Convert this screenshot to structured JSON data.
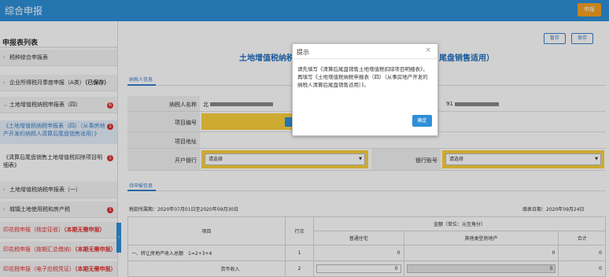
{
  "header": {
    "title": "综合申报",
    "report_button": "申报"
  },
  "sidebar": {
    "title": "申报表列表",
    "items": [
      {
        "label": "税种综合申报表"
      },
      {
        "label": "企业所得税月季度申报（A类）",
        "status": "（已保存）"
      },
      {
        "label": "土地增值税纳税申报表（四）",
        "badge": "6"
      },
      {
        "label": "《土地增值税纳税申报表（四）（从事房地产开发的纳税人清算后尾盘销售适用）》",
        "badge": "1"
      },
      {
        "label": "《清算后尾盘销售土地增值税扣除项目明细表》",
        "badge": "1"
      },
      {
        "label": "土地增值税纳税申报表（一）"
      },
      {
        "label": "城镇土地使用税和房产税",
        "badge": "1"
      },
      {
        "label": "印花税申报（核定征收）",
        "status": "（本期无需申报）"
      },
      {
        "label": "印花税申报（按期汇总缴纳）",
        "status": "（本期无需申报）"
      },
      {
        "label": "印花税申报（电子应税凭证）",
        "status": "（本期无需申报）"
      }
    ],
    "collapse_icon": "‹"
  },
  "toolbar": {
    "draft": "暂存",
    "save": "保存"
  },
  "form": {
    "title": "土地增值税纳税申报表（四）（从事房地产开发的纳税人清算后尾盘销售适用）",
    "title_left": "土地增值税纳税",
    "title_right": "尾盘销售适用）",
    "taxpayer_tab": "纳税人信息",
    "taxpayer_name_label": "纳税人名称",
    "taxpayer_name_prefix": "北",
    "taxpayer_id_prefix": "91",
    "project_no_label": "项目编号",
    "project_addr_label": "项目地址",
    "bank_label": "开户银行",
    "account_label": "银行账号",
    "select_placeholder": "请选择",
    "declare_tab": "待申报信息",
    "period": "税款所属期：2020年07月01日至2020年09月30日",
    "fill_date": "填表日期：2020年09月24日",
    "amount_header": "金额（单位：元至角分）",
    "col_item": "项目",
    "col_row": "行次",
    "col_ordinary": "普通住宅",
    "col_other": "其他类型房地产",
    "col_total": "合计",
    "rows": [
      {
        "item": "一、转让房地产收入总额　1=2+3+4",
        "no": "1",
        "ordinary": "0",
        "other": "0",
        "total": "0"
      },
      {
        "item": "货币收入",
        "no": "2",
        "ordinary": "0",
        "other": "0",
        "total": "0"
      }
    ]
  },
  "dialog": {
    "title": "提示",
    "close": "×",
    "message": "请先填写《清算后尾盘销售土地增值税扣除项目明细表》，再填写《土地增值税纳税申报表（四）（从事房地产开发的纳税人清算后尾盘销售适用）》。",
    "ok": "确定"
  }
}
